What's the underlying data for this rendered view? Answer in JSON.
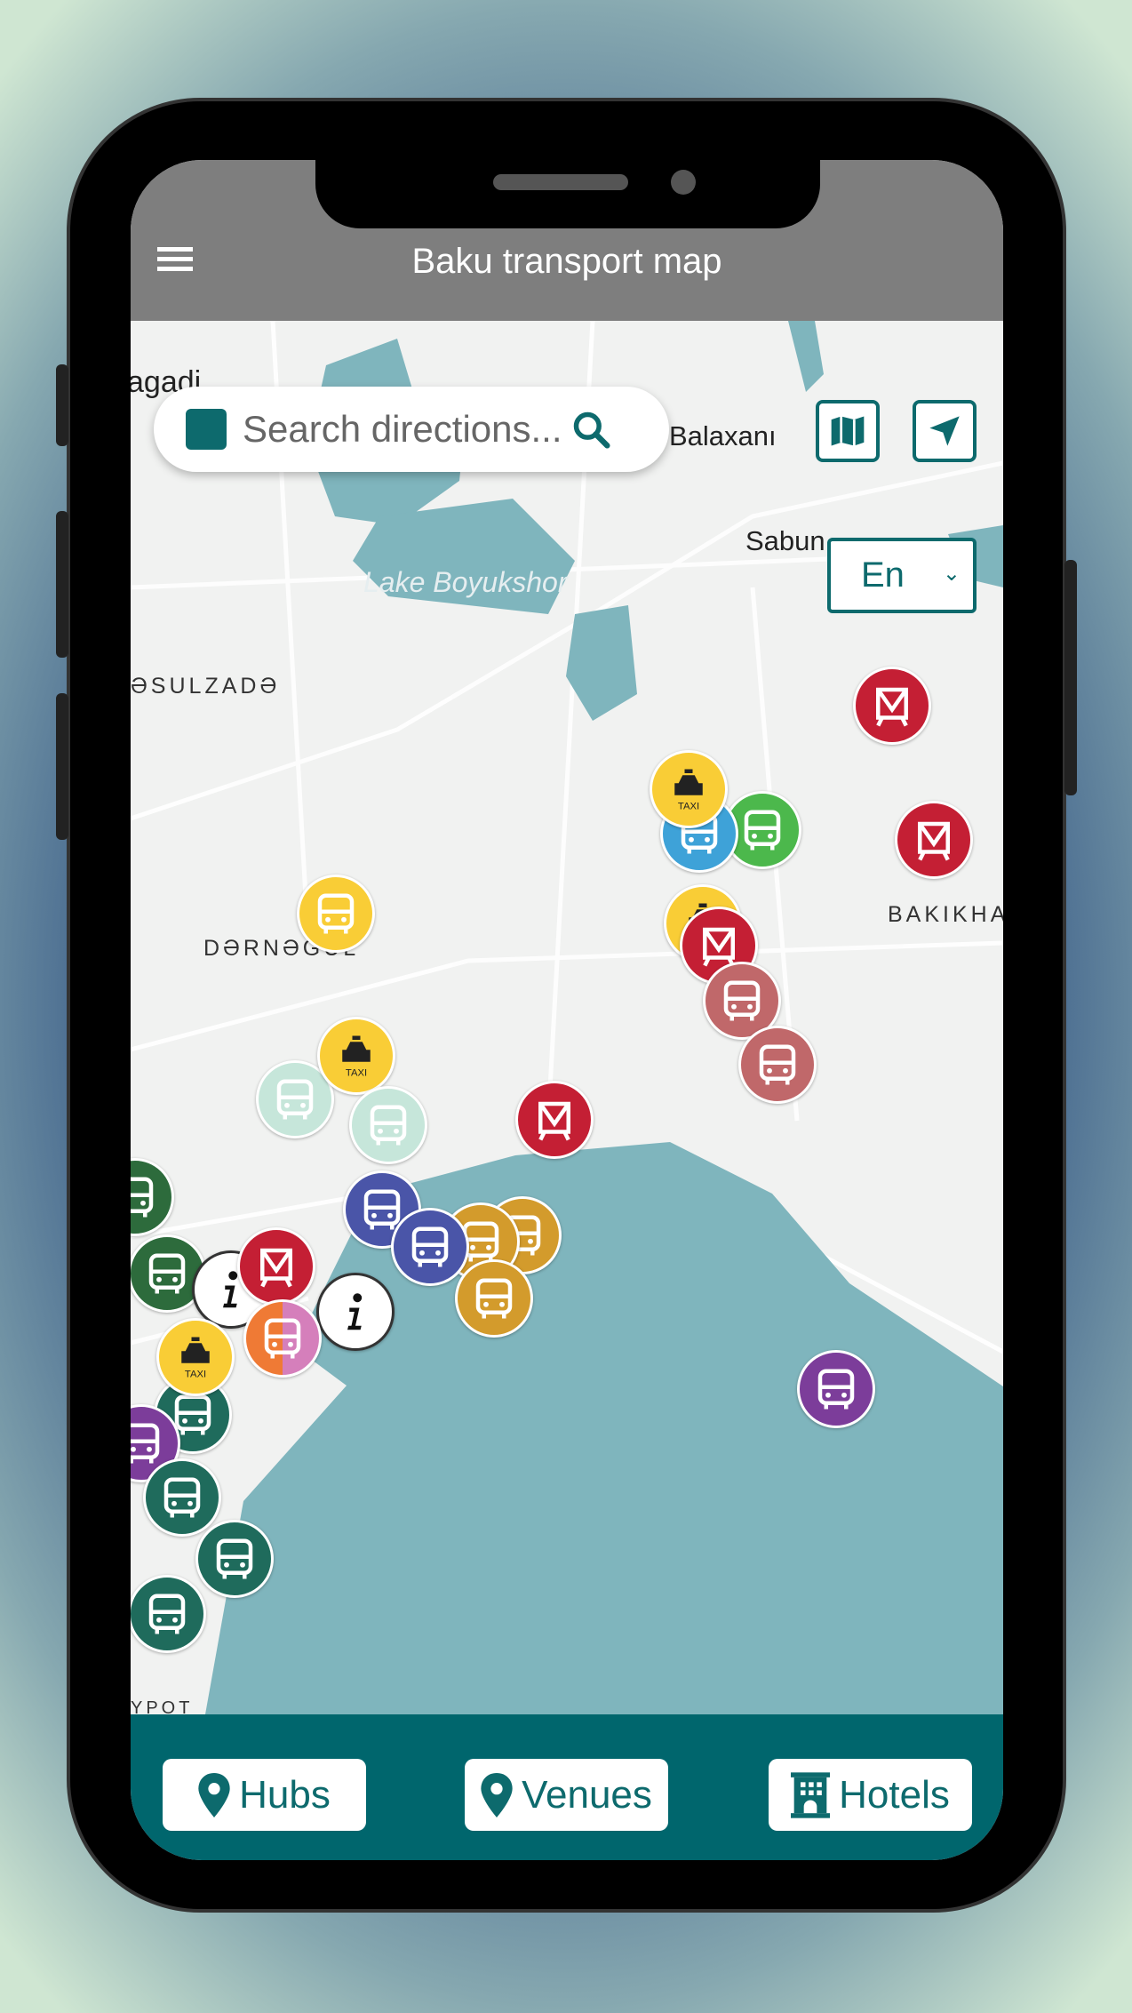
{
  "header": {
    "title": "Baku transport map",
    "menu_icon": "hamburger-icon"
  },
  "search": {
    "placeholder": "Search directions..."
  },
  "map_labels": {
    "agadi": "agadi",
    "balaxani": "Balaxanı",
    "sabun": "Sabun",
    "lake": "Lake Boyukshor",
    "rasulzade": "ƏSULZADƏ",
    "darnagul": "DƏRNƏGÜL",
    "bakikha": "BAKIKHA",
    "ypot": "YPOT"
  },
  "controls": {
    "map_icon": "map-icon",
    "locate_icon": "navigation-arrow-icon",
    "language": "En"
  },
  "marker_legend": {
    "bus": "bus-icon",
    "metro": "metro-icon",
    "taxi": "taxi-icon",
    "info": "info-icon",
    "taxi_label": "TAXI"
  },
  "bottom": {
    "hubs": "Hubs",
    "venues": "Venues",
    "hotels": "Hotels"
  },
  "colors": {
    "accent": "#0d6a6d",
    "header": "#7e7e7e",
    "water": "#7fb5bd",
    "bottom_bar": "#00666d"
  }
}
